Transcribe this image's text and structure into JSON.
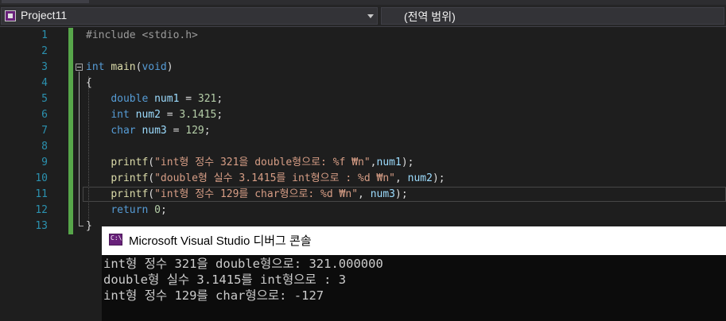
{
  "navbar": {
    "project": "Project11",
    "scope": "(전역 범위)"
  },
  "editor": {
    "line_numbers": [
      "1",
      "2",
      "3",
      "4",
      "5",
      "6",
      "7",
      "8",
      "9",
      "10",
      "11",
      "12",
      "13"
    ],
    "lines": {
      "l1": "#include <stdio.h>",
      "l3_kw": "int",
      "l3_fn": "main",
      "l3_open": "(",
      "l3_void": "void",
      "l3_close": ")",
      "l4": "{",
      "l5_kw": "double",
      "l5_var": "num1",
      "l5_eq": " = ",
      "l5_num": "321",
      "l5_end": ";",
      "l6_kw": "int",
      "l6_var": "num2",
      "l6_eq": " = ",
      "l6_num": "3.1415",
      "l6_end": ";",
      "l7_kw": "char",
      "l7_var": "num3",
      "l7_eq": " = ",
      "l7_num": "129",
      "l7_end": ";",
      "l9_fn": "printf",
      "l9_open": "(",
      "l9_str": "\"int형 정수 321을 double형으로: %f ₩n\"",
      "l9_comma": ",",
      "l9_var": "num1",
      "l9_end": ");",
      "l10_fn": "printf",
      "l10_open": "(",
      "l10_str": "\"double형 실수 3.1415를 int형으로 : %d ₩n\"",
      "l10_comma": ", ",
      "l10_var": "num2",
      "l10_end": ");",
      "l11_fn": "printf",
      "l11_open": "(",
      "l11_str": "\"int형 정수 129를 char형으로: %d ₩n\"",
      "l11_comma": ", ",
      "l11_var": "num3",
      "l11_end": ");",
      "l12_kw": "return",
      "l12_num": "0",
      "l12_end": ";",
      "l13": "}"
    }
  },
  "console": {
    "title": "Microsoft Visual Studio 디버그 콘솔",
    "icon_text": "C:\\",
    "output": [
      "int형 정수 321을 double형으로: 321.000000",
      "double형 실수 3.1415를 int형으로 : 3",
      "int형 정수 129를 char형으로: -127"
    ]
  },
  "icons": {
    "project": "cpp-project-icon",
    "dropdown": "chevron-down-icon",
    "console": "console-app-icon"
  },
  "colors": {
    "keyword": "#569cd6",
    "string": "#d69d85",
    "function": "#dcdcaa",
    "number": "#b5cea8",
    "variable": "#9cdcfe",
    "line_number": "#2b91af",
    "change_bar": "#57a64a"
  }
}
